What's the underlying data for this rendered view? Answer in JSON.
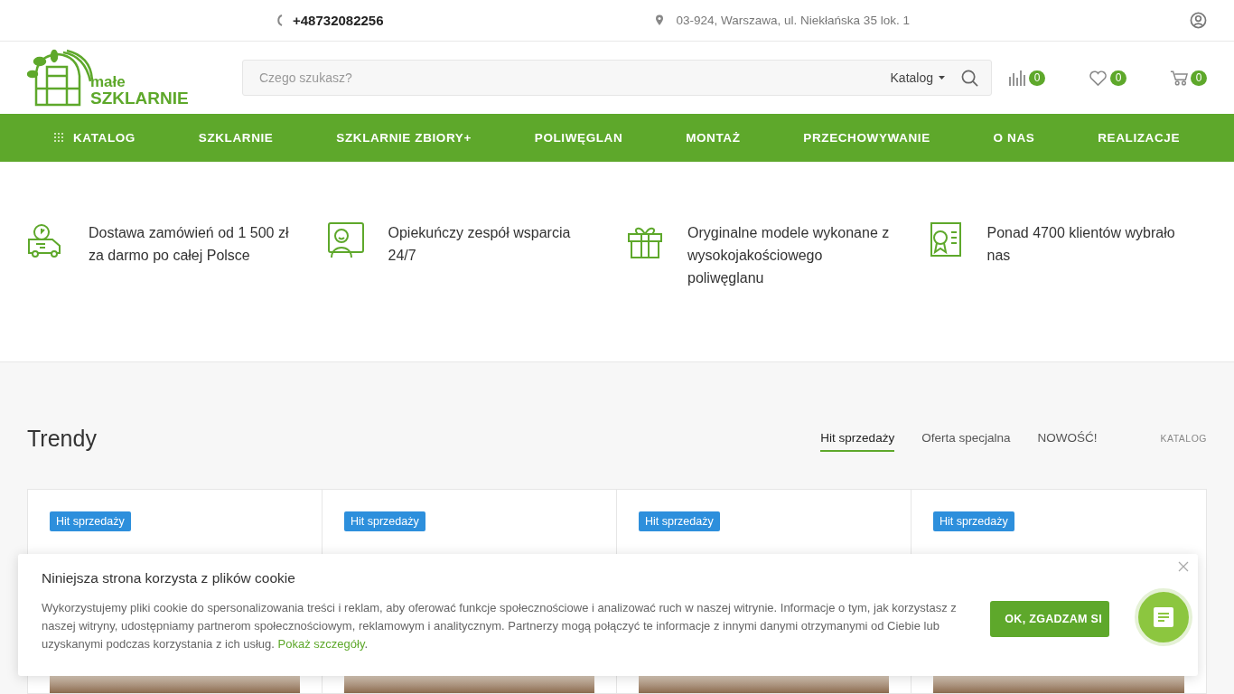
{
  "topbar": {
    "phone": "+48732082256",
    "address": "03-924, Warszawa, ul. Niekłańska 35 lok. 1"
  },
  "header": {
    "logo": {
      "line1": "małe",
      "line2": "SZKLARNIE"
    },
    "search": {
      "placeholder": "Czego szukasz?",
      "scope": "Katalog"
    },
    "counters": [
      {
        "kind": "compare",
        "count": "0"
      },
      {
        "kind": "wishlist",
        "count": "0"
      },
      {
        "kind": "cart",
        "count": "0"
      }
    ]
  },
  "nav": [
    {
      "label": "KATALOG",
      "kind": "catalog"
    },
    {
      "label": "SZKLARNIE",
      "kind": "link"
    },
    {
      "label": "SZKLARNIE ZBIORY+",
      "kind": "link"
    },
    {
      "label": "POLIWĘGLAN",
      "kind": "link"
    },
    {
      "label": "MONTAŻ",
      "kind": "link"
    },
    {
      "label": "PRZECHOWYWANIE",
      "kind": "link"
    },
    {
      "label": "O NAS",
      "kind": "link"
    },
    {
      "label": "REALIZACJE",
      "kind": "link"
    }
  ],
  "features": [
    {
      "kind": "delivery",
      "text": "Dostawa zamówień od 1 500 zł za darmo po całej Polsce"
    },
    {
      "kind": "support",
      "text": "Opiekuńczy zespół wsparcia 24/7"
    },
    {
      "kind": "gift",
      "text": "Oryginalne modele wykonane z wysokojakościowego poliwęglanu"
    },
    {
      "kind": "certificate",
      "text": "Ponad 4700 klientów wybrało nas"
    }
  ],
  "trends": {
    "title": "Trendy",
    "tabs": [
      {
        "label": "Hit sprzedaży",
        "selected": true
      },
      {
        "label": "Oferta specjalna",
        "selected": false
      },
      {
        "label": "NOWOŚĆ!",
        "selected": false
      }
    ],
    "catalog_link": "KATALOG",
    "products": [
      {
        "badge": "Hit sprzedaży"
      },
      {
        "badge": "Hit sprzedaży"
      },
      {
        "badge": "Hit sprzedaży"
      },
      {
        "badge": "Hit sprzedaży"
      }
    ]
  },
  "cookie": {
    "title": "Niniejsza strona korzysta z plików cookie",
    "text": "Wykorzystujemy pliki cookie do spersonalizowania treści i reklam, aby oferować funkcje społecznościowe i analizować ruch w naszej witrynie. Informacje o tym, jak korzystasz z naszej witryny, udostępniamy partnerom społecznościowym, reklamowym i analitycznym. Partnerzy mogą połączyć te informacje z innymi danymi otrzymanymi od Ciebie lub uzyskanymi podczas korzystania z ich usług.",
    "link": "Pokaż szczegóły",
    "link_end": ".",
    "button": "OK, ZGADZAM SI"
  }
}
